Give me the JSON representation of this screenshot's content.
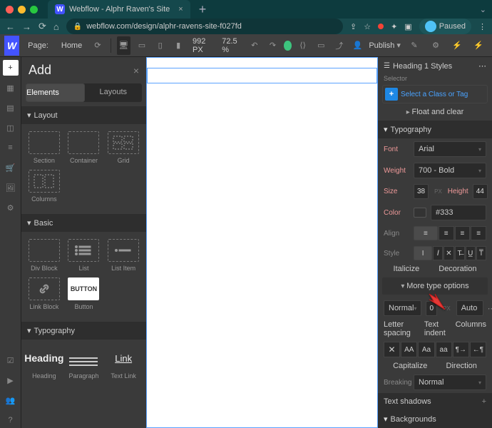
{
  "browser": {
    "tab_title": "Webflow - Alphr Raven's Site",
    "url": "webflow.com/design/alphr-ravens-site-f027fd",
    "paused": "Paused"
  },
  "topbar": {
    "page_label": "Page:",
    "page_name": "Home",
    "width_px": "992",
    "zoom": "72.5",
    "publish": "Publish"
  },
  "add_panel": {
    "title": "Add",
    "tabs": {
      "elements": "Elements",
      "layouts": "Layouts"
    },
    "sections": {
      "layout": "Layout",
      "basic": "Basic",
      "typography": "Typography"
    },
    "layout_items": [
      "Section",
      "Container",
      "Grid",
      "Columns"
    ],
    "basic_items": [
      "Div Block",
      "List",
      "List Item",
      "Link Block",
      "Button"
    ],
    "button_label": "BUTTON",
    "typo_items": [
      "Heading",
      "Paragraph",
      "Text Link"
    ],
    "typo_samples": {
      "heading": "Heading",
      "link": "Link"
    }
  },
  "styles": {
    "header": "Heading 1 Styles",
    "selector": "Selector",
    "select_placeholder": "Select a Class or Tag",
    "float": "Float and clear",
    "typography": "Typography",
    "font_lbl": "Font",
    "font_val": "Arial",
    "weight_lbl": "Weight",
    "weight_val": "700 - Bold",
    "size_lbl": "Size",
    "size_val": "38",
    "height_lbl": "Height",
    "height_val": "44",
    "color_lbl": "Color",
    "color_val": "#333",
    "align_lbl": "Align",
    "style_lbl": "Style",
    "italicize": "Italicize",
    "decoration": "Decoration",
    "more": "More type options",
    "normal": "Normal",
    "auto": "Auto",
    "letter": "Letter spacing",
    "indent": "Text indent",
    "columns": "Columns",
    "capitalize": "Capitalize",
    "direction": "Direction",
    "breaking_lbl": "Breaking",
    "breaking_val": "Normal",
    "shadows": "Text shadows",
    "backgrounds": "Backgrounds",
    "px": "PX",
    "zero": "0"
  }
}
